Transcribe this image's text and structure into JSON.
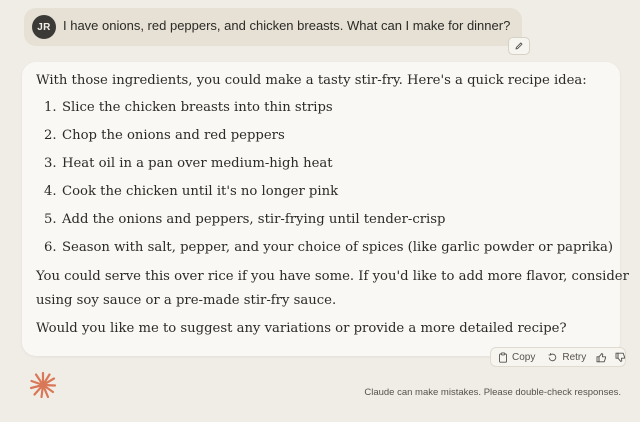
{
  "user_message": {
    "avatar_initials": "JR",
    "text": "I have onions, red peppers, and chicken breasts. What can I make for dinner?"
  },
  "assistant_message": {
    "intro": "With those ingredients, you could make a tasty stir-fry. Here's a quick recipe idea:",
    "steps": [
      {
        "num": "1.",
        "text": "Slice the chicken breasts into thin strips"
      },
      {
        "num": "2.",
        "text": "Chop the onions and red peppers"
      },
      {
        "num": "3.",
        "text": "Heat oil in a pan over medium-high heat"
      },
      {
        "num": "4.",
        "text": "Cook the chicken until it's no longer pink"
      },
      {
        "num": "5.",
        "text": "Add the onions and peppers, stir-frying until tender-crisp"
      },
      {
        "num": "6.",
        "text": "Season with salt, pepper, and your choice of spices (like garlic powder or paprika)"
      }
    ],
    "paragraph1_line1": "You could serve this over rice if you have some. If you'd like to add more flavor, consider",
    "paragraph1_line2": "using soy sauce or a pre-made stir-fry sauce.",
    "paragraph2": "Would you like me to suggest any variations or provide a more detailed recipe?"
  },
  "actions": {
    "copy_label": "Copy",
    "retry_label": "Retry"
  },
  "footer": {
    "disclaimer": "Claude can make mistakes. Please double-check responses."
  },
  "icons": {
    "edit": "pencil-icon",
    "copy": "clipboard-icon",
    "retry": "retry-icon",
    "thumbs_up": "thumbs-up-icon",
    "thumbs_down": "thumbs-down-icon",
    "logo": "claude-starburst-icon"
  },
  "colors": {
    "background": "#f0ede6",
    "user_bubble": "#e6e1d4",
    "assistant_card": "#faf8f4",
    "avatar": "#3b3a36",
    "brand_orange": "#d97757",
    "text": "#2b2a27"
  }
}
